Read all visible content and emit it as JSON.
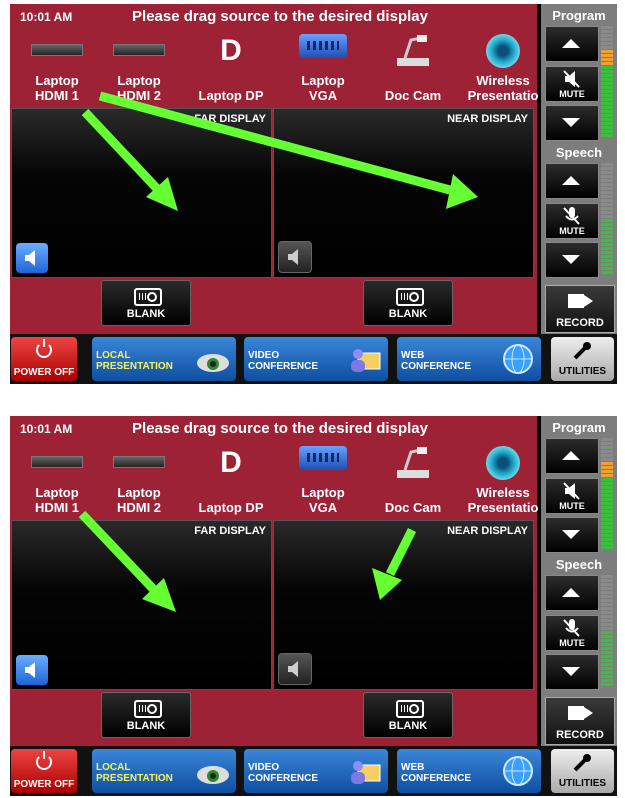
{
  "screens": [
    {
      "time": "10:01 AM",
      "title": "Please drag source to the desired display",
      "sources": [
        "Laptop\nHDMI 1",
        "Laptop\nHDMI 2",
        "Laptop DP",
        "Laptop\nVGA",
        "Doc Cam",
        "Wireless\nPresentatio"
      ],
      "far_display": "FAR DISPLAY",
      "near_display": "NEAR DISPLAY",
      "blank": "BLANK",
      "program": "Program",
      "speech": "Speech",
      "mute": "MUTE",
      "record": "RECORD",
      "power_off": "POWER OFF",
      "local_presentation": "LOCAL\nPRESENTATION",
      "video_conference": "VIDEO\nCONFERENCE",
      "web_conference": "WEB\nCONFERENCE",
      "utilities": "UTILITIES"
    },
    {
      "time": "10:01 AM",
      "title": "Please drag source to the desired display",
      "sources": [
        "Laptop\nHDMI 1",
        "Laptop\nHDMI 2",
        "Laptop DP",
        "Laptop\nVGA",
        "Doc Cam",
        "Wireless\nPresentatio"
      ],
      "far_display": "FAR DISPLAY",
      "near_display": "NEAR DISPLAY",
      "blank": "BLANK",
      "program": "Program",
      "speech": "Speech",
      "mute": "MUTE",
      "record": "RECORD",
      "power_off": "POWER OFF",
      "local_presentation": "LOCAL\nPRESENTATION",
      "video_conference": "VIDEO\nCONFERENCE",
      "web_conference": "WEB\nCONFERENCE",
      "utilities": "UTILITIES"
    }
  ],
  "colors": {
    "panel_red": "#9d2236",
    "arrow_green": "#66ff33",
    "button_blue": "#1f64d6"
  },
  "icons": [
    "hdmi-icon",
    "displayport-icon",
    "vga-icon",
    "doc-cam-icon",
    "wireless-icon",
    "speaker-icon",
    "projector-icon",
    "mute-icon",
    "mic-mute-icon",
    "video-camera-icon",
    "power-icon",
    "wrench-icon"
  ]
}
